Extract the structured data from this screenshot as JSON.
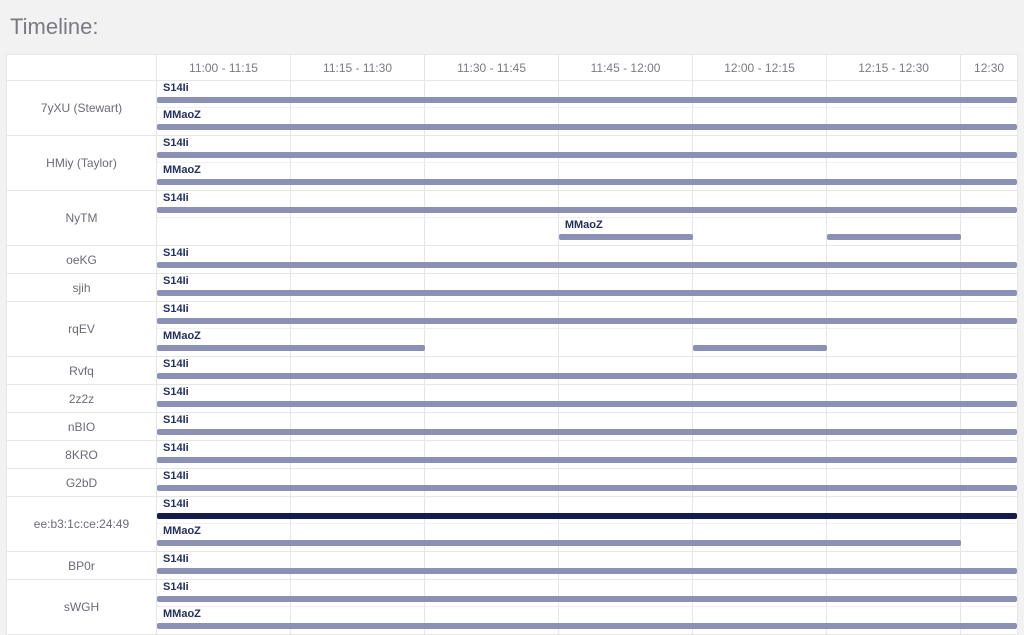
{
  "title": "Timeline:",
  "time_columns": [
    "11:00 - 11:15",
    "11:15 - 11:30",
    "11:30 - 11:45",
    "11:45 - 12:00",
    "12:00 - 12:15",
    "12:15 - 12:30",
    "12:30"
  ],
  "col_weights": [
    1,
    1,
    1,
    1,
    1,
    1,
    0.42
  ],
  "tracks_palette": {
    "light": "light",
    "dark": "dark"
  },
  "rows": [
    {
      "label": "7yXU (Stewart)",
      "tracks": [
        {
          "tag": "S14Ii",
          "segments": [
            {
              "start": 0,
              "end": 6.42,
              "style": "light"
            }
          ]
        },
        {
          "tag": "MMaoZ",
          "segments": [
            {
              "start": 0,
              "end": 6.42,
              "style": "light"
            }
          ]
        }
      ]
    },
    {
      "label": "HMiy (Taylor)",
      "tracks": [
        {
          "tag": "S14Ii",
          "segments": [
            {
              "start": 0,
              "end": 6.42,
              "style": "light"
            }
          ]
        },
        {
          "tag": "MMaoZ",
          "segments": [
            {
              "start": 0,
              "end": 6.42,
              "style": "light"
            }
          ]
        }
      ]
    },
    {
      "label": "NyTM",
      "tracks": [
        {
          "tag": "S14Ii",
          "segments": [
            {
              "start": 0,
              "end": 6.42,
              "style": "light"
            }
          ]
        },
        {
          "tag": "MMaoZ",
          "tagOffset": 3.0,
          "segments": [
            {
              "start": 3.0,
              "end": 4.0,
              "style": "light"
            },
            {
              "start": 5.0,
              "end": 6.0,
              "style": "light"
            }
          ]
        }
      ]
    },
    {
      "label": "oeKG",
      "tracks": [
        {
          "tag": "S14Ii",
          "segments": [
            {
              "start": 0,
              "end": 6.42,
              "style": "light"
            }
          ]
        }
      ]
    },
    {
      "label": "sjih",
      "tracks": [
        {
          "tag": "S14Ii",
          "segments": [
            {
              "start": 0,
              "end": 6.42,
              "style": "light"
            }
          ]
        }
      ]
    },
    {
      "label": "rqEV",
      "tracks": [
        {
          "tag": "S14Ii",
          "segments": [
            {
              "start": 0,
              "end": 6.42,
              "style": "light"
            }
          ]
        },
        {
          "tag": "MMaoZ",
          "segments": [
            {
              "start": 0,
              "end": 2.0,
              "style": "light"
            },
            {
              "start": 4.0,
              "end": 5.0,
              "style": "light"
            }
          ]
        }
      ]
    },
    {
      "label": "Rvfq",
      "tracks": [
        {
          "tag": "S14Ii",
          "segments": [
            {
              "start": 0,
              "end": 6.42,
              "style": "light"
            }
          ]
        }
      ]
    },
    {
      "label": "2z2z",
      "tracks": [
        {
          "tag": "S14Ii",
          "segments": [
            {
              "start": 0,
              "end": 6.42,
              "style": "light"
            }
          ]
        }
      ]
    },
    {
      "label": "nBIO",
      "tracks": [
        {
          "tag": "S14Ii",
          "segments": [
            {
              "start": 0,
              "end": 6.42,
              "style": "light"
            }
          ]
        }
      ]
    },
    {
      "label": "8KRO",
      "tracks": [
        {
          "tag": "S14Ii",
          "segments": [
            {
              "start": 0,
              "end": 6.42,
              "style": "light"
            }
          ]
        }
      ]
    },
    {
      "label": "G2bD",
      "tracks": [
        {
          "tag": "S14Ii",
          "segments": [
            {
              "start": 0,
              "end": 6.42,
              "style": "light"
            }
          ]
        }
      ]
    },
    {
      "label": "ee:b3:1c:ce:24:49",
      "tracks": [
        {
          "tag": "S14Ii",
          "segments": [
            {
              "start": 0,
              "end": 6.42,
              "style": "dark"
            }
          ]
        },
        {
          "tag": "MMaoZ",
          "segments": [
            {
              "start": 0,
              "end": 6.0,
              "style": "light"
            }
          ]
        }
      ]
    },
    {
      "label": "BP0r",
      "tracks": [
        {
          "tag": "S14Ii",
          "segments": [
            {
              "start": 0,
              "end": 6.42,
              "style": "light"
            }
          ]
        }
      ]
    },
    {
      "label": "sWGH",
      "tracks": [
        {
          "tag": "S14Ii",
          "segments": [
            {
              "start": 0,
              "end": 6.42,
              "style": "light"
            }
          ]
        },
        {
          "tag": "MMaoZ",
          "segments": [
            {
              "start": 0,
              "end": 6.42,
              "style": "light"
            }
          ]
        }
      ]
    }
  ]
}
